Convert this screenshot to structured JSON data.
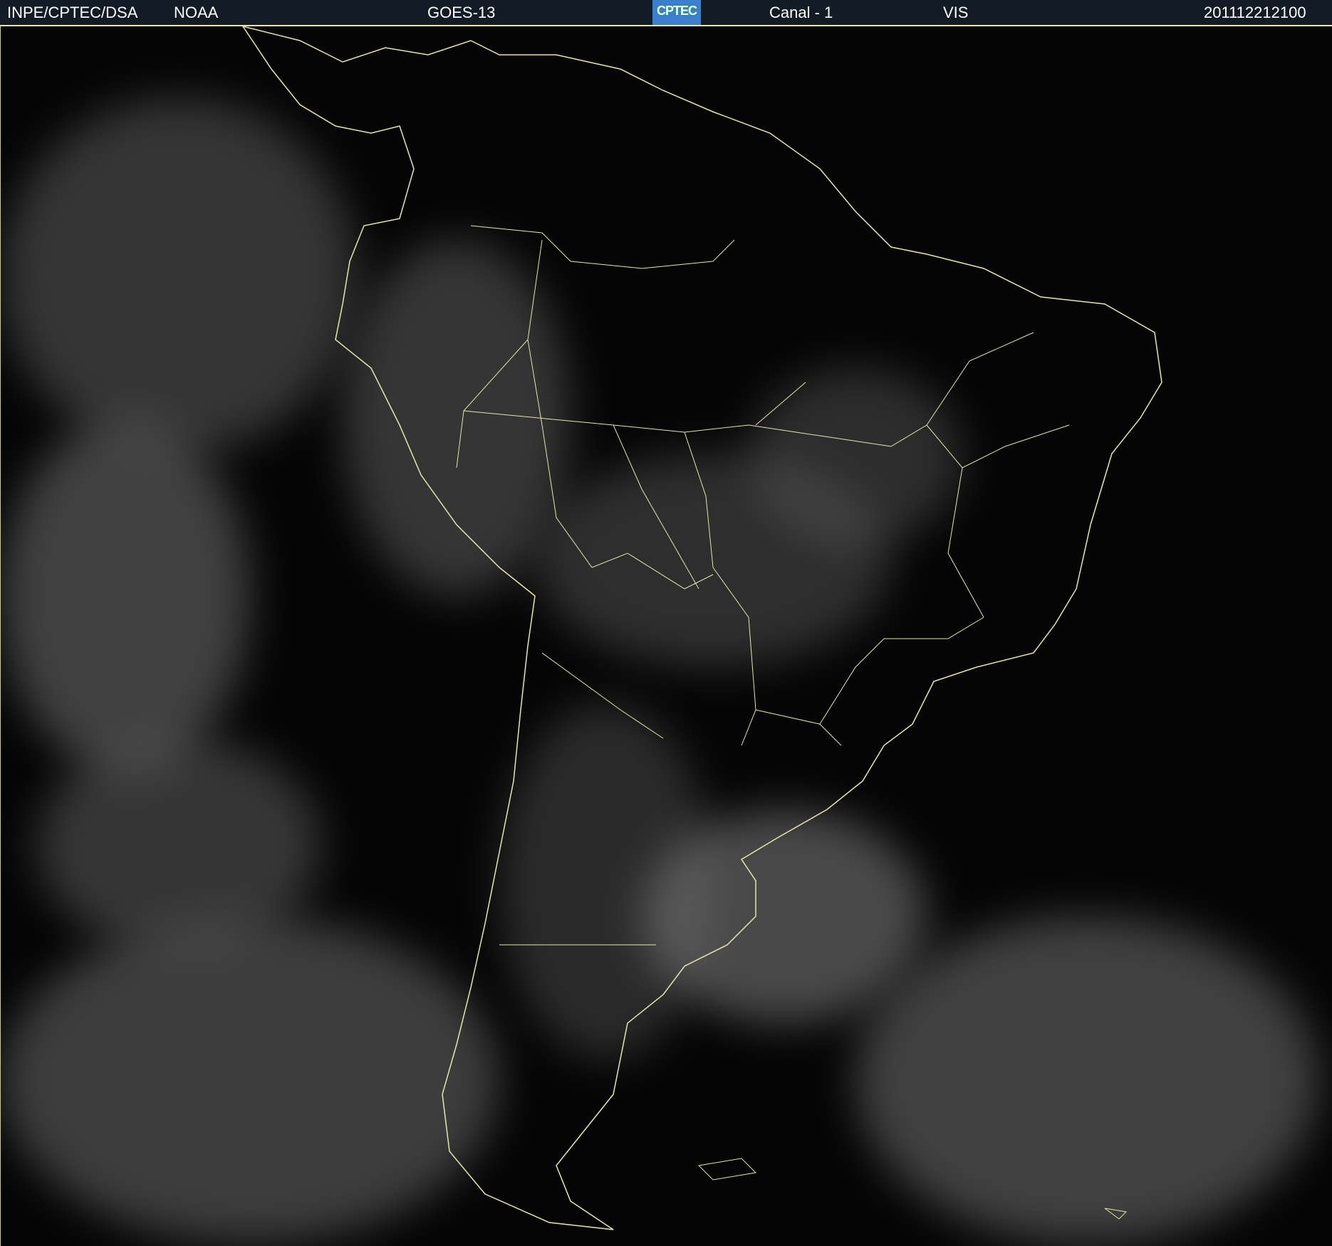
{
  "header": {
    "org": "INPE/CPTEC/DSA",
    "agency": "NOAA",
    "satellite": "GOES-13",
    "logo_text": "CPTEC",
    "channel": "Canal - 1",
    "band": "VIS",
    "datetime": "201112212100"
  },
  "colors": {
    "header_bg": "#111c26",
    "border": "#e8e6a8",
    "coastline": "#e8e6a8"
  }
}
